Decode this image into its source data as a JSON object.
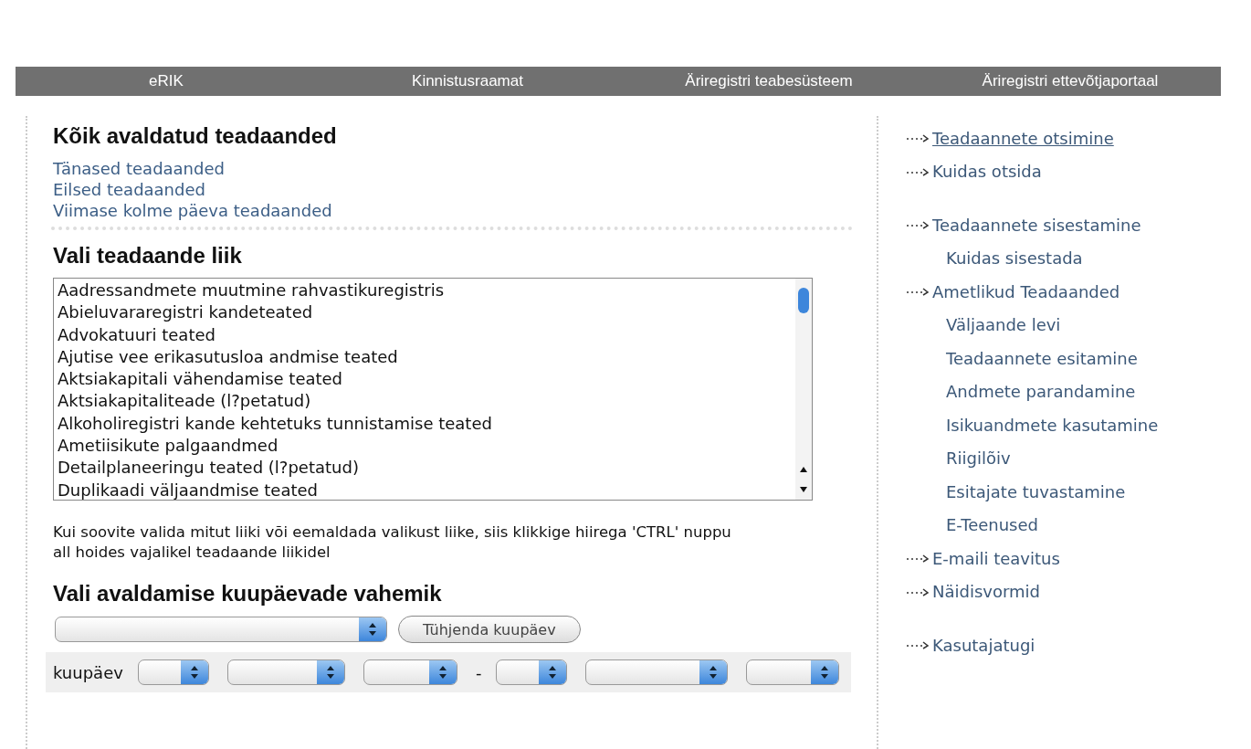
{
  "top_nav": [
    "eRIK",
    "Kinnistusraamat",
    "Äriregistri teabesüsteem",
    "Äriregistri ettevõtjaportaal"
  ],
  "main": {
    "heading": "Kõik avaldatud teadaanded",
    "quick_links": [
      "Tänased teadaanded",
      "Eilsed teadaanded",
      "Viimase kolme päeva teadaanded"
    ],
    "type_heading": "Vali teadaande liik",
    "types": [
      "Aadressandmete muutmine rahvastikuregistris",
      "Abieluvararegistri kandeteated",
      "Advokatuuri teated",
      "Ajutise vee erikasutusloa andmise teated",
      "Aktsiakapitali vähendamise teated",
      "Aktsiakapitaliteade (l?petatud)",
      "Alkoholiregistri kande kehtetuks tunnistamise teated",
      "Ametiisikute palgaandmed",
      "Detailplaneeringu teated (l?petatud)",
      "Duplikaadi väljaandmise teated"
    ],
    "hint": "Kui soovite valida mitut liiki või eemaldada valikust liike, siis klikkige hiirega 'CTRL' nuppu all hoides vajalikel teadaande liikidel",
    "date_heading": "Vali avaldamise kuupäevade vahemik",
    "clear_button": "Tühjenda kuupäev",
    "date_label": "kuupäev",
    "range_separator": "-"
  },
  "sidebar": {
    "groups": [
      {
        "items": [
          {
            "label": "Teadaannete otsimine",
            "kind": "main",
            "selected": true
          },
          {
            "label": "Kuidas otsida",
            "kind": "main",
            "selected": false
          }
        ]
      },
      {
        "items": [
          {
            "label": "Teadaannete sisestamine",
            "kind": "main",
            "selected": false
          },
          {
            "label": "Kuidas sisestada",
            "kind": "sub",
            "selected": false
          },
          {
            "label": "Ametlikud Teadaanded",
            "kind": "main",
            "selected": false
          },
          {
            "label": "Väljaande levi",
            "kind": "sub",
            "selected": false
          },
          {
            "label": "Teadaannete esitamine",
            "kind": "sub",
            "selected": false
          },
          {
            "label": "Andmete parandamine",
            "kind": "sub",
            "selected": false
          },
          {
            "label": "Isikuandmete kasutamine",
            "kind": "sub",
            "selected": false
          },
          {
            "label": "Riigilõiv",
            "kind": "sub",
            "selected": false
          },
          {
            "label": "Esitajate tuvastamine",
            "kind": "sub",
            "selected": false
          },
          {
            "label": "E-Teenused",
            "kind": "sub",
            "selected": false
          },
          {
            "label": "E-maili teavitus",
            "kind": "main",
            "selected": false
          },
          {
            "label": "Näidisvormid",
            "kind": "main",
            "selected": false
          }
        ]
      },
      {
        "items": [
          {
            "label": "Kasutajatugi",
            "kind": "main",
            "selected": false
          }
        ]
      }
    ]
  }
}
